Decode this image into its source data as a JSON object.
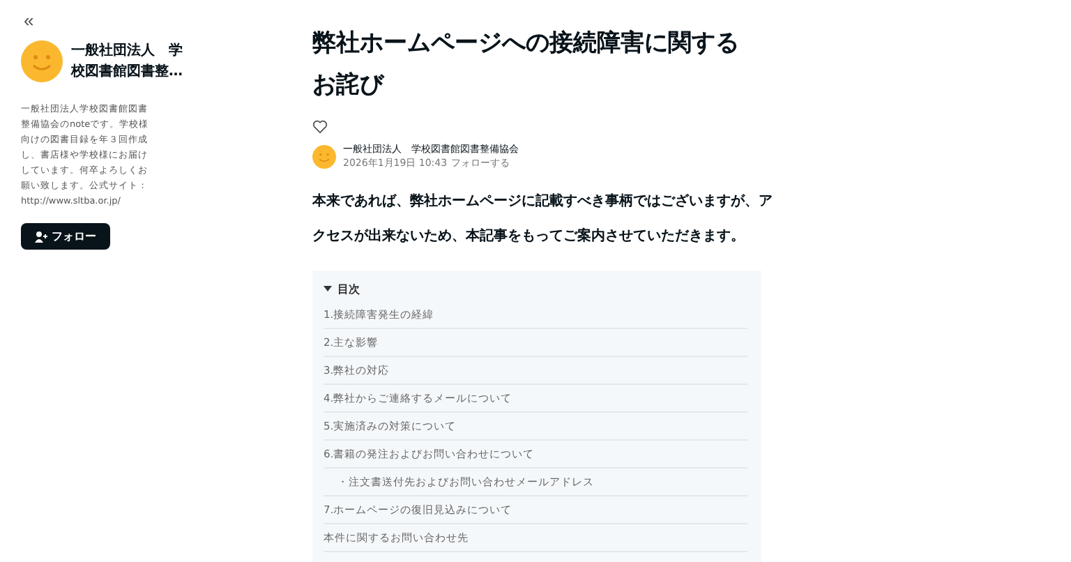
{
  "sidebar": {
    "collapse_icon": "«",
    "name": "一般社団法人　学校図書館図書整…",
    "description": "一般社団法人学校図書館図書整備協会のnoteです。学校様向けの図書目録を年３回作成し、書店様や学校様にお届けしています。何卒よろしくお願い致します。公式サイト：",
    "link": "http://www.sltba.or.jp/",
    "follow_button": "フォロー"
  },
  "article": {
    "title": "弊社ホームページへの接続障害に関するお詫び",
    "liked": false,
    "author": "一般社団法人　学校図書館図書整備協会",
    "date": "2026年1月19日 10:43",
    "follow_link": "フォローする",
    "lead": "本来であれば、弊社ホームページに記載すべき事柄ではございますが、アクセスが出来ないため、本記事をもってご案内させていただきます。",
    "toc": {
      "heading": "目次",
      "expanded": true,
      "items": [
        {
          "label": "1.接続障害発生の経緯"
        },
        {
          "label": "2.主な影響"
        },
        {
          "label": "3.弊社の対応"
        },
        {
          "label": "4.弊社からご連絡するメールについて"
        },
        {
          "label": "5.実施済みの対策について"
        },
        {
          "label": "6.書籍の発注およびお問い合わせについて",
          "children": [
            {
              "label": "・注文書送付先およびお問い合わせメールアドレス"
            }
          ]
        },
        {
          "label": "7.ホームページの復旧見込みについて"
        },
        {
          "label": "本件に関するお問い合わせ先"
        }
      ]
    }
  }
}
